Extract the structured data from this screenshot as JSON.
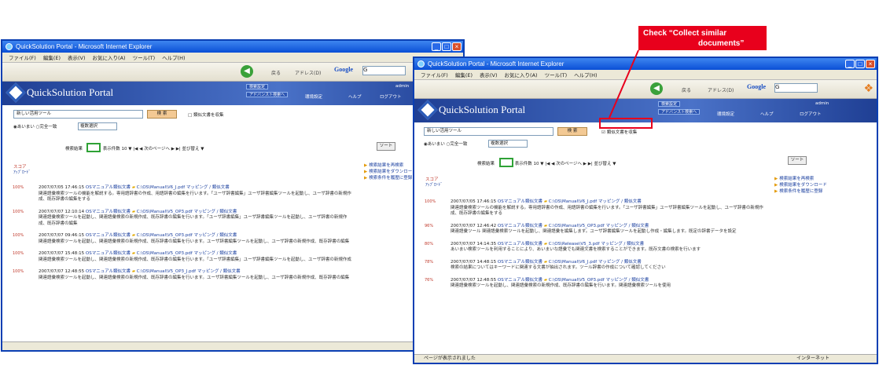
{
  "window": {
    "title": "QuickSolution Portal - Microsoft Internet Explorer"
  },
  "menu": [
    "ファイル(F)",
    "編集(E)",
    "表示(V)",
    "お気に入り(A)",
    "ツール(T)",
    "ヘルプ(H)"
  ],
  "toolbar": {
    "back": "戻る",
    "address": "アドレス(D)",
    "google": "Google",
    "google_input": "G"
  },
  "portal": {
    "logo": "QuickSolution Portal",
    "advanced_search": "アドバンスト検索へ",
    "settings_chip": "検索設定",
    "user": "admin",
    "links": [
      "環境設定",
      "ヘルプ",
      "ログアウト"
    ]
  },
  "search": {
    "query": "新しい活用ツール",
    "button": "検 索",
    "collect_similar": "類似文書を収集",
    "radio_and": "あいまい",
    "radio_full": "完全一致",
    "select": "複数選択"
  },
  "pager": {
    "prefix": "検索結果",
    "current": "10件",
    "per_page": "表示件数",
    "per_page_value": "10",
    "next": "次のページへ",
    "sort": "並び替え",
    "sort_btn": "ソート"
  },
  "side_links": [
    "検索結果を再検索",
    "検索結果をダウンロード",
    "検索条件を履歴に登録"
  ],
  "sort_label": "スコア",
  "sort_label2": "ｱｯﾌﾟﾛｰﾄﾞ",
  "results_w1": [
    {
      "score": "100%",
      "date": "2007/07/05 17:46:15",
      "type": "OSマニュアル類似文書",
      "path": "C:\\OS\\Manual\\V6_J.pdf",
      "tags": "マッピング / 類似文書",
      "body": "関連語彙検索ツールの機能を解説する。専用語辞書の作成、用語辞書の編集を行います。「ユーザ辞書編集」ユーザ辞書編集ツールを起動し、ユーザ辞書の新規作成、既存辞書の編集をする"
    },
    {
      "score": "100%",
      "date": "2007/07/07 12:10:14",
      "type": "OSマニュアル類似文書",
      "path": "C:\\OS\\Manual\\V5_OP3.pdf",
      "tags": "マッピング / 類似文書",
      "body": "関連語彙検索ツールを起動し、関連語彙検索の新規作成、既存辞書の編集を行います。「ユーザ辞書編集」ユーザ辞書編集ツールを起動し、ユーザ辞書の新規作成、既存辞書の編集"
    },
    {
      "score": "100%",
      "date": "2007/07/07 09:46:15",
      "type": "OSマニュアル類似文書",
      "path": "C:\\OS\\Manual\\V5_OP3.pdf",
      "tags": "マッピング / 類似文書",
      "body": "関連語彙検索ツールを起動し、関連語彙検索の新規作成、既存辞書の編集を行います。ユーザ辞書編集ツールを起動し、ユーザ辞書の新規作成、既存辞書の編集"
    },
    {
      "score": "100%",
      "date": "2007/07/07 15:48:15",
      "type": "OSマニュアル類似文書",
      "path": "C:\\OS\\Manual\\V5_OP3.pdf",
      "tags": "マッピング / 類似文書",
      "body": "関連語彙検索ツールを起動し、関連語彙検索の新規作成、既存辞書の編集を行います。「ユーザ辞書編集」ユーザ辞書編集ツールを起動し、ユーザ辞書の新規作成"
    },
    {
      "score": "100%",
      "date": "2007/07/07 12:48:55",
      "type": "OSマニュアル類似文書",
      "path": "C:\\OS\\Manual\\V5_OP3_J.pdf",
      "tags": "マッピング / 類似文書",
      "body": "関連語彙検索ツールを起動し、関連語彙検索の新規作成、既存辞書の編集を行います。ユーザ辞書編集ツールを起動し、ユーザ辞書の新規作成、既存辞書の編集"
    }
  ],
  "results_w2": [
    {
      "score": "100%",
      "date": "2007/07/05 17:46:15",
      "type": "OSマニュアル類似文書",
      "path": "C:\\OS\\Manual\\V6_J.pdf",
      "tags": "マッピング / 類似文書",
      "body": "関連語彙検索ツールの機能を解説する。専用語辞書の作成、用語辞書の編集を行います。「ユーザ辞書編集」ユーザ辞書編集ツールを起動し、ユーザ辞書の新規作成、既存辞書の編集をする"
    },
    {
      "score": "96%",
      "date": "2007/07/07 12:46:42",
      "type": "OSマニュアル類似文書",
      "path": "C:\\OS\\Manual\\V5_OP3.pdf",
      "tags": "マッピング / 類似文書",
      "body": "関連語彙ツール 関連語彙検索ツールを起動し、関連語彙を編集します。ユーザ辞書編集ツールを起動し作成・編集します。既定の辞書データを設定"
    },
    {
      "score": "80%",
      "date": "2007/07/07 14:14:35",
      "type": "OSマニュアル類似文書",
      "path": "C:\\OS\\Release\\V5_3.pdf",
      "tags": "マッピング / 類似文書",
      "body": "あいまい検索ツールを利用することにより、あいまいな語彙でも関連文書を検索することができます。既存文書の検索を行います"
    },
    {
      "score": "78%",
      "date": "2007/07/07 14:48:15",
      "type": "OSマニュアル類似文書",
      "path": "C:\\OS\\Manual\\V6_J.pdf",
      "tags": "マッピング / 類似文書",
      "body": "検索の結果についてはキーワードに関連する文書が抽出されます。ツール辞書の作成について確認してください"
    },
    {
      "score": "76%",
      "date": "2007/07/07 12:48:55",
      "type": "OSマニュアル類似文書",
      "path": "C:\\OS\\Manual\\V5_OP3.pdf",
      "tags": "マッピング / 類似文書",
      "body": "関連語彙検索ツールを起動し、関連語彙検索の新規作成、既存辞書の編集を行います。関連語彙検索ツールを使用"
    }
  ],
  "status": {
    "left": "ページが表示されました",
    "right": "インターネット"
  },
  "callout": {
    "line1": "Check “Collect similar",
    "line2": "documents”"
  },
  "colors": {
    "callout": "#e8001c",
    "highlight": "#2fa236",
    "titlebar": "#0a4fd6"
  }
}
